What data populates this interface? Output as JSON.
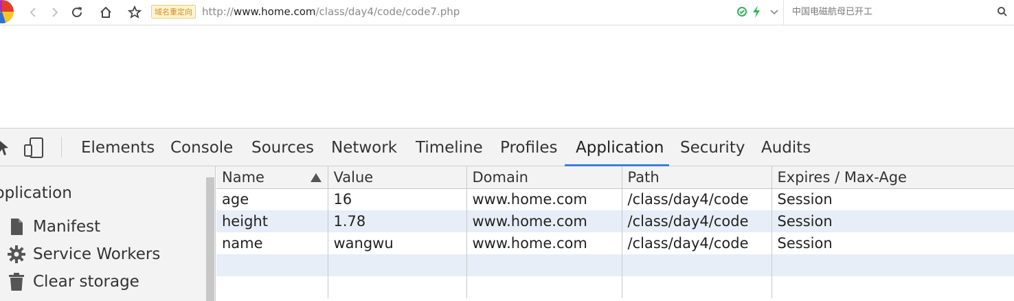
{
  "toolbar": {
    "redirect_badge": "域名重定向",
    "url_scheme": "http://",
    "url_host": "www.home.com",
    "url_path": "/class/day4/code/code7.php",
    "search_placeholder": "中国电磁航母已开工"
  },
  "devtools": {
    "tabs": [
      {
        "label": "Elements"
      },
      {
        "label": "Console"
      },
      {
        "label": "Sources"
      },
      {
        "label": "Network"
      },
      {
        "label": "Timeline"
      },
      {
        "label": "Profiles"
      },
      {
        "label": "Application"
      },
      {
        "label": "Security"
      },
      {
        "label": "Audits"
      }
    ],
    "active_tab": "Application"
  },
  "sidebar": {
    "title": "pplication",
    "items": [
      {
        "label": "Manifest",
        "icon": "file-icon"
      },
      {
        "label": "Service Workers",
        "icon": "gear-icon"
      },
      {
        "label": "Clear storage",
        "icon": "trash-icon"
      }
    ]
  },
  "cookies": {
    "columns": [
      "Name",
      "Value",
      "Domain",
      "Path",
      "Expires / Max-Age"
    ],
    "rows": [
      [
        "age",
        "16",
        "www.home.com",
        "/class/day4/code",
        "Session"
      ],
      [
        "height",
        "1.78",
        "www.home.com",
        "/class/day4/code",
        "Session"
      ],
      [
        "name",
        "wangwu",
        "www.home.com",
        "/class/day4/code",
        "Session"
      ]
    ]
  },
  "colors": {
    "accent": "#3a7fdc",
    "row_alt": "#e8eef8",
    "redirect_badge_bg": "#fff4cf"
  }
}
